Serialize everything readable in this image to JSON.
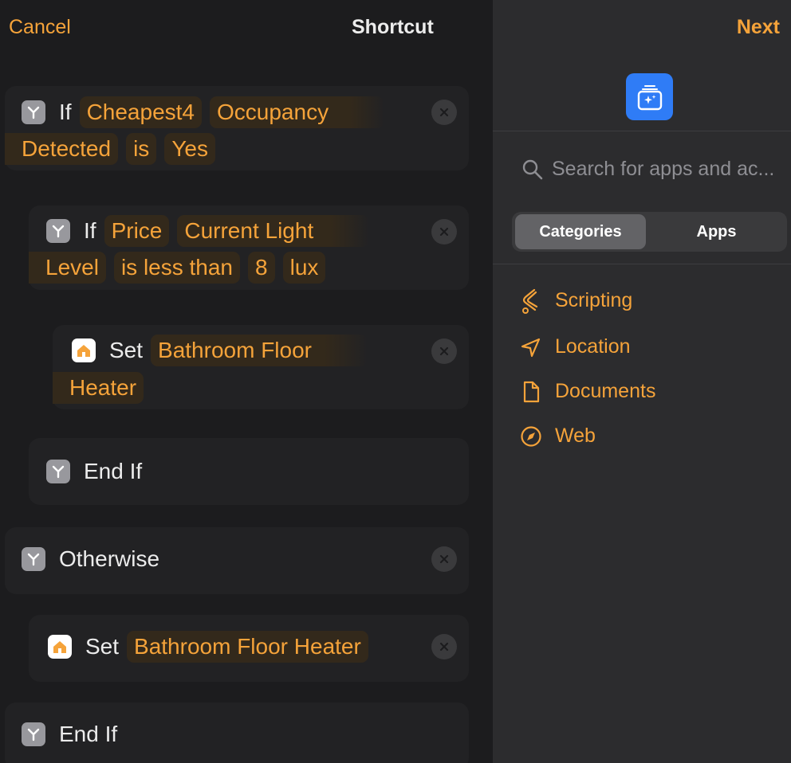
{
  "nav": {
    "cancel": "Cancel",
    "title": "Shortcut",
    "next": "Next"
  },
  "actions": {
    "if1": {
      "keyword": "If",
      "tokens": [
        "Cheapest4",
        "Occupancy",
        "Detected",
        "is",
        "Yes"
      ]
    },
    "if2": {
      "keyword": "If",
      "tokens": [
        "Price",
        "Current Light",
        "Level",
        "is less than",
        "8",
        "lux"
      ]
    },
    "set1": {
      "keyword": "Set",
      "tokens": [
        "Bathroom Floor",
        "Heater"
      ]
    },
    "endif1": {
      "keyword": "End If"
    },
    "otherwise": {
      "keyword": "Otherwise"
    },
    "set2": {
      "keyword": "Set",
      "tokens": [
        "Bathroom Floor Heater"
      ]
    },
    "endif2": {
      "keyword": "End If"
    }
  },
  "sidebar": {
    "search_placeholder": "Search for apps and ac...",
    "segments": {
      "active": "Categories",
      "inactive": "Apps"
    },
    "categories": [
      {
        "label": "Scripting",
        "icon": "scripting-icon"
      },
      {
        "label": "Location",
        "icon": "location-arrow-icon"
      },
      {
        "label": "Documents",
        "icon": "document-icon"
      },
      {
        "label": "Web",
        "icon": "compass-icon"
      }
    ]
  },
  "colors": {
    "accent": "#f5a33a",
    "background": "#1c1c1e",
    "sidebar": "#2c2c2e",
    "app_icon": "#2f7cf6"
  }
}
